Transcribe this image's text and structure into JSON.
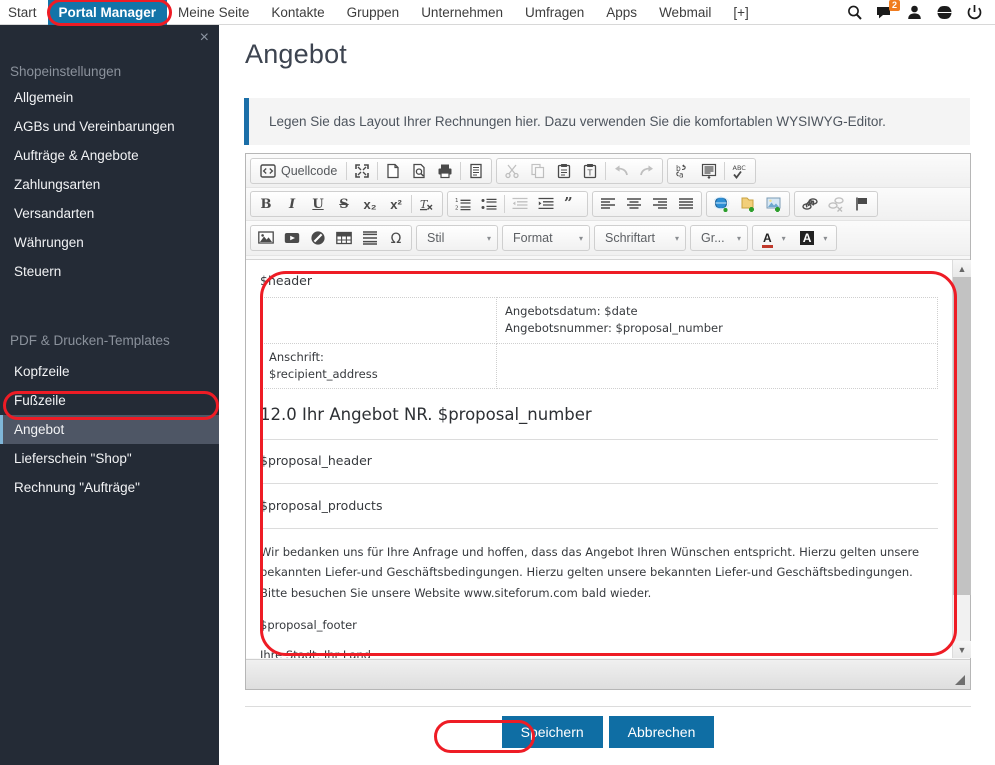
{
  "topnav": {
    "items": [
      {
        "label": "Start",
        "active": false
      },
      {
        "label": "Portal Manager",
        "active": true
      },
      {
        "label": "Meine Seite",
        "active": false
      },
      {
        "label": "Kontakte",
        "active": false
      },
      {
        "label": "Gruppen",
        "active": false
      },
      {
        "label": "Unternehmen",
        "active": false
      },
      {
        "label": "Umfragen",
        "active": false
      },
      {
        "label": "Apps",
        "active": false
      },
      {
        "label": "Webmail",
        "active": false
      },
      {
        "label": "[+]",
        "active": false
      }
    ],
    "icons": [
      "search-icon",
      "messages-icon",
      "user-icon",
      "globe-icon",
      "power-icon"
    ],
    "message_badge": "2",
    "active_color": "#1374a8",
    "badge_color": "#f07c1f"
  },
  "sidebar": {
    "close_label": "×",
    "group1_title": "Shopeinstellungen",
    "group1_items": [
      {
        "label": "Allgemein"
      },
      {
        "label": "AGBs und Vereinbarungen"
      },
      {
        "label": "Aufträge & Angebote"
      },
      {
        "label": "Zahlungsarten"
      },
      {
        "label": "Versandarten"
      },
      {
        "label": "Währungen"
      },
      {
        "label": "Steuern"
      }
    ],
    "group2_title": "PDF & Drucken-Templates",
    "group2_items": [
      {
        "label": "Kopfzeile",
        "active": false
      },
      {
        "label": "Fußzeile",
        "active": false
      },
      {
        "label": "Angebot",
        "active": true
      },
      {
        "label": "Lieferschein \"Shop\"",
        "active": false
      },
      {
        "label": "Rechnung \"Aufträge\"",
        "active": false
      }
    ],
    "background": "#242b36",
    "active_background": "#4e5665"
  },
  "main": {
    "page_title": "Angebot",
    "info_banner": "Legen Sie das Layout Ihrer Rechnungen hier. Dazu verwenden Sie die komfortablen WYSIWYG-Editor.",
    "info_accent": "#1b6fa8"
  },
  "editor": {
    "toolbar_row1": [
      {
        "group": [
          {
            "name": "source-code-button",
            "label": "Quellcode",
            "icon": "source-code-icon",
            "wide": true,
            "dim": false
          },
          {
            "sep": true
          },
          {
            "name": "maximize-button",
            "label": "",
            "icon": "maximize-icon",
            "dim": false
          },
          {
            "sep": true
          },
          {
            "name": "new-page-button",
            "label": "",
            "icon": "new-page-icon",
            "dim": false
          },
          {
            "name": "preview-button",
            "label": "",
            "icon": "preview-icon",
            "dim": false
          },
          {
            "name": "print-button",
            "label": "",
            "icon": "print-icon",
            "dim": false
          },
          {
            "sep": true
          },
          {
            "name": "templates-button",
            "label": "",
            "icon": "templates-icon",
            "dim": false
          }
        ]
      },
      {
        "group": [
          {
            "name": "cut-button",
            "label": "",
            "icon": "scissors-icon",
            "dim": true
          },
          {
            "name": "copy-button",
            "label": "",
            "icon": "copy-icon",
            "dim": true
          },
          {
            "name": "paste-button",
            "label": "",
            "icon": "paste-icon",
            "dim": false
          },
          {
            "name": "paste-text-button",
            "label": "",
            "icon": "paste-text-icon",
            "dim": false
          },
          {
            "sep": true
          },
          {
            "name": "undo-button",
            "label": "",
            "icon": "undo-arrow-icon",
            "dim": true
          },
          {
            "name": "redo-button",
            "label": "",
            "icon": "redo-arrow-icon",
            "dim": true
          }
        ]
      },
      {
        "group": [
          {
            "name": "find-replace-button",
            "label": "",
            "icon": "replace-icon",
            "dim": false
          },
          {
            "name": "select-all-button",
            "label": "",
            "icon": "select-all-icon",
            "dim": false
          },
          {
            "sep": true
          },
          {
            "name": "spellcheck-button",
            "label": "",
            "icon": "spellcheck-abc-icon",
            "dim": false
          }
        ]
      }
    ],
    "toolbar_row2": [
      {
        "group": [
          {
            "name": "bold-button",
            "label": "B",
            "icon": "bold-icon",
            "dim": false
          },
          {
            "name": "italic-button",
            "label": "I",
            "icon": "italic-icon",
            "dim": false
          },
          {
            "name": "underline-button",
            "label": "U",
            "icon": "underline-icon",
            "dim": false
          },
          {
            "name": "strikethrough-button",
            "label": "S",
            "icon": "strikethrough-icon",
            "dim": false
          },
          {
            "name": "subscript-button",
            "label": "x₂",
            "icon": "subscript-icon",
            "dim": false
          },
          {
            "name": "superscript-button",
            "label": "x²",
            "icon": "superscript-icon",
            "dim": false
          },
          {
            "sep": true
          },
          {
            "name": "remove-format-button",
            "label": "",
            "icon": "remove-format-icon",
            "dim": false
          }
        ]
      },
      {
        "group": [
          {
            "name": "numbered-list-button",
            "label": "",
            "icon": "numbered-list-icon",
            "dim": false
          },
          {
            "name": "bullet-list-button",
            "label": "",
            "icon": "bullet-list-icon",
            "dim": false
          },
          {
            "sep": true
          },
          {
            "name": "outdent-button",
            "label": "",
            "icon": "outdent-icon",
            "dim": true
          },
          {
            "name": "indent-button",
            "label": "",
            "icon": "indent-icon",
            "dim": false
          },
          {
            "name": "blockquote-button",
            "label": "",
            "icon": "blockquote-icon",
            "dim": false
          }
        ]
      },
      {
        "group": [
          {
            "name": "align-left-button",
            "label": "",
            "icon": "align-left-icon",
            "dim": false
          },
          {
            "name": "align-center-button",
            "label": "",
            "icon": "align-center-icon",
            "dim": false
          },
          {
            "name": "align-right-button",
            "label": "",
            "icon": "align-right-icon",
            "dim": false
          },
          {
            "name": "align-justify-button",
            "label": "",
            "icon": "align-justify-icon",
            "dim": false
          }
        ]
      },
      {
        "group": [
          {
            "name": "insert-link-globe-button",
            "label": "",
            "icon": "globe-add-icon",
            "dim": false
          },
          {
            "name": "insert-file-button",
            "label": "",
            "icon": "file-add-icon",
            "dim": false
          },
          {
            "name": "insert-picture-button",
            "label": "",
            "icon": "picture-add-icon",
            "dim": false
          }
        ]
      },
      {
        "group": [
          {
            "name": "link-button",
            "label": "",
            "icon": "link-icon",
            "dim": false
          },
          {
            "name": "unlink-button",
            "label": "",
            "icon": "unlink-icon",
            "dim": true
          },
          {
            "name": "anchor-button",
            "label": "",
            "icon": "flag-anchor-icon",
            "dim": false
          }
        ]
      }
    ],
    "toolbar_row3": [
      {
        "group": [
          {
            "name": "image-button",
            "label": "",
            "icon": "image-icon",
            "dim": false
          },
          {
            "name": "video-button",
            "label": "",
            "icon": "video-icon",
            "dim": false
          },
          {
            "name": "flash-button",
            "label": "",
            "icon": "flash-icon",
            "dim": false
          },
          {
            "name": "table-button",
            "label": "",
            "icon": "table-icon",
            "dim": false
          },
          {
            "name": "horizontal-rule-button",
            "label": "",
            "icon": "horizontal-rule-icon",
            "dim": false
          },
          {
            "name": "special-char-button",
            "label": "Ω",
            "icon": "omega-icon",
            "dim": false
          }
        ]
      }
    ],
    "selects": [
      {
        "name": "style-select",
        "label": "Stil"
      },
      {
        "name": "format-select",
        "label": "Format"
      },
      {
        "name": "font-select",
        "label": "Schriftart"
      },
      {
        "name": "size-select",
        "label": "Gr..."
      }
    ],
    "color_buttons": [
      {
        "name": "text-color-button",
        "label": "A",
        "icon": "text-color-icon"
      },
      {
        "name": "background-color-button",
        "label": "A",
        "icon": "background-color-icon"
      }
    ],
    "document": {
      "header_var": "$header",
      "addr_table": [
        [
          "",
          "Angebotsdatum: $date\nAngebotsnummer: $proposal_number"
        ],
        [
          "Anschrift:\n$recipient_address",
          ""
        ]
      ],
      "cell_r1c1": "",
      "cell_r1c2_line1": "Angebotsdatum: $date",
      "cell_r1c2_line2": "Angebotsnummer: $proposal_number",
      "cell_r2c1_line1": "Anschrift:",
      "cell_r2c1_line2": "$recipient_address",
      "cell_r2c2": "",
      "title": "12.0 Ihr Angebot NR. $proposal_number",
      "section_header": "$proposal_header",
      "section_products": "$proposal_products",
      "paragraph": "Wir bedanken uns für Ihre Anfrage und hoffen, dass das Angebot Ihren Wünschen entspricht. Hierzu gelten unsere bekannten Liefer-und Geschäftsbedingungen. Hierzu gelten unsere bekannten Liefer-und Geschäftsbedingungen. Bitte besuchen Sie unsere Website www.siteforum.com bald wieder.",
      "footer_var": "$proposal_footer",
      "city_country": "Ihre Stadt, Ihr Land"
    }
  },
  "actions": {
    "save_label": "Speichern",
    "cancel_label": "Abbrechen",
    "button_color": "#0f6ea4"
  },
  "annotations": {
    "highlight_color": "#ee1c25"
  }
}
